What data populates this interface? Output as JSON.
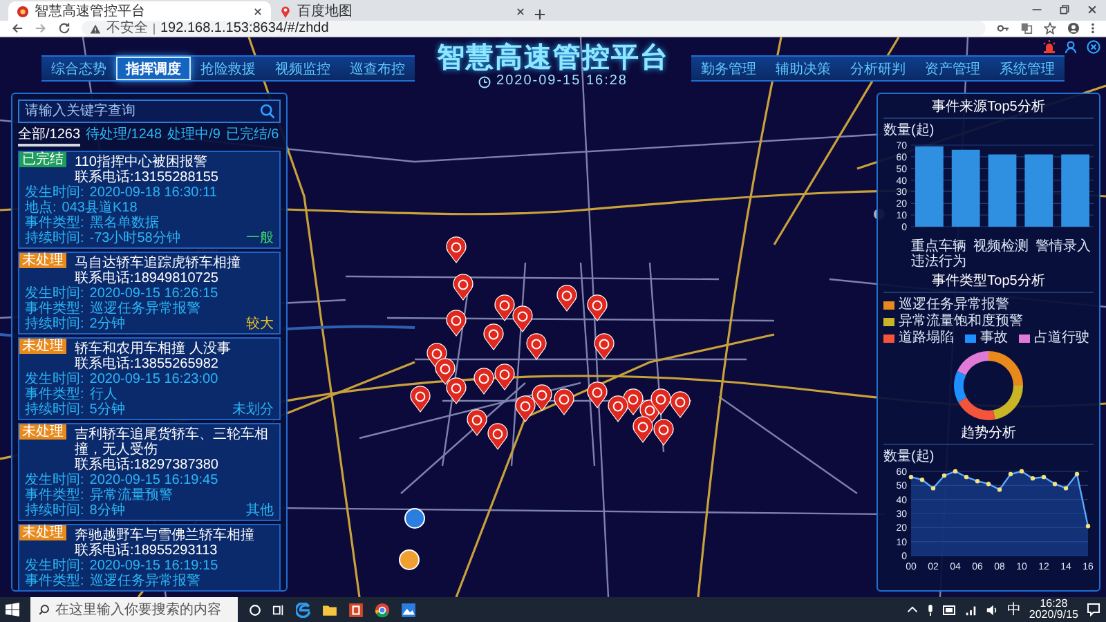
{
  "browser": {
    "tabs": [
      {
        "title": "智慧高速管控平台",
        "selected": true
      },
      {
        "title": "百度地图",
        "selected": false
      }
    ],
    "security": "不安全",
    "url": "192.168.1.153:8634/#/zhdd"
  },
  "header": {
    "title": "智慧高速管控平台",
    "datetime": "2020-09-15 16:28",
    "left_nav": [
      {
        "label": "综合态势",
        "selected": false
      },
      {
        "label": "指挥调度",
        "selected": true
      },
      {
        "label": "抢险救援",
        "selected": false
      },
      {
        "label": "视频监控",
        "selected": false
      },
      {
        "label": "巡查布控",
        "selected": false
      }
    ],
    "right_nav": [
      {
        "label": "勤务管理",
        "selected": false
      },
      {
        "label": "辅助决策",
        "selected": false
      },
      {
        "label": "分析研判",
        "selected": false
      },
      {
        "label": "资产管理",
        "selected": false
      },
      {
        "label": "系统管理",
        "selected": false
      }
    ]
  },
  "event_panel": {
    "search": {
      "placeholder": "请输入关键字查询"
    },
    "filters": [
      {
        "label": "全部/1263",
        "selected": true
      },
      {
        "label": "待处理/1248",
        "selected": false
      },
      {
        "label": "处理中/9",
        "selected": false
      },
      {
        "label": "已完结/6",
        "selected": false
      }
    ],
    "events": [
      {
        "badge": {
          "text": "已完结",
          "color": "#1f9d5c"
        },
        "title": "110指挥中心被困报警",
        "contact": "联系电话:13155288155",
        "fields": [
          {
            "label": "发生时间:",
            "value": "2020-09-18 16:30:11"
          },
          {
            "label": "地点:",
            "value": "043县道K18"
          },
          {
            "label": "事件类型:",
            "value": "黑名单数据"
          },
          {
            "label": "持续时间:",
            "value": "-73小时58分钟"
          }
        ],
        "severity": {
          "text": "一般",
          "color": "#3ccf6e"
        }
      },
      {
        "badge": {
          "text": "未处理",
          "color": "#e8891c"
        },
        "title": "马自达轿车追踪虎轿车相撞",
        "contact": "联系电话:18949810725",
        "fields": [
          {
            "label": "发生时间:",
            "value": "2020-09-15 16:26:15"
          },
          {
            "label": "事件类型:",
            "value": "巡逻任务异常报警"
          },
          {
            "label": "持续时间:",
            "value": "2分钟"
          }
        ],
        "severity": {
          "text": "较大",
          "color": "#e6c229"
        }
      },
      {
        "badge": {
          "text": "未处理",
          "color": "#e8891c"
        },
        "title": "轿车和农用车相撞 人没事",
        "contact": "联系电话:13855265982",
        "fields": [
          {
            "label": "发生时间:",
            "value": "2020-09-15 16:23:00"
          },
          {
            "label": "事件类型:",
            "value": "行人"
          },
          {
            "label": "持续时间:",
            "value": "5分钟"
          }
        ],
        "severity": {
          "text": "未划分",
          "color": "#29b6f6"
        }
      },
      {
        "badge": {
          "text": "未处理",
          "color": "#e8891c"
        },
        "title": "吉利轿车追尾货轿车、三轮车相撞，无人受伤",
        "contact": "联系电话:18297387380",
        "fields": [
          {
            "label": "发生时间:",
            "value": "2020-09-15 16:19:45"
          },
          {
            "label": "事件类型:",
            "value": "异常流量预警"
          },
          {
            "label": "持续时间:",
            "value": "8分钟"
          }
        ],
        "severity": {
          "text": "其他",
          "color": "#29b6f6"
        }
      },
      {
        "badge": {
          "text": "未处理",
          "color": "#e8891c"
        },
        "title": "奔驰越野车与雪佛兰轿车相撞",
        "contact": "联系电话:18955293113",
        "fields": [
          {
            "label": "发生时间:",
            "value": "2020-09-15 16:19:15"
          },
          {
            "label": "事件类型:",
            "value": "巡逻任务异常报警"
          }
        ]
      }
    ]
  },
  "analysis_panel": {
    "sections": [
      {
        "title": "事件来源Top5分析",
        "chart_data": {
          "type": "bar",
          "ylabel": "数量(起)",
          "categories": [
            "重点车辆违法行为",
            null,
            "视频检测",
            null,
            "警情录入"
          ],
          "values": [
            69,
            66,
            62,
            62,
            62
          ],
          "ylim": [
            0,
            70
          ],
          "grid": true,
          "yticks": [
            0,
            10,
            20,
            30,
            40,
            50,
            60,
            70
          ]
        }
      },
      {
        "title": "事件类型Top5分析",
        "chart_data": {
          "type": "donut",
          "legend": "top",
          "categories": [
            "巡逻任务异常报警",
            "异常流量饱和度预警",
            "道路塌陷",
            "事故",
            "占道行驶"
          ],
          "colors": [
            "#e8891c",
            "#c9b526",
            "#f4533c",
            "#1e90ff",
            "#e07ad6"
          ],
          "values": [
            25,
            22,
            20,
            15,
            18
          ]
        }
      },
      {
        "title": "趋势分析",
        "chart_data": {
          "type": "area",
          "ylabel": "数量(起)",
          "x": [
            0,
            1,
            2,
            3,
            4,
            5,
            6,
            7,
            8,
            9,
            10,
            11,
            12,
            13,
            14,
            15,
            16
          ],
          "values": [
            56,
            54,
            48,
            57,
            60,
            56,
            53,
            51,
            47,
            58,
            60,
            55,
            56,
            51,
            48,
            58,
            21
          ],
          "xlim": [
            0,
            16
          ],
          "ylim": [
            0,
            60
          ],
          "grid": true,
          "yticks": [
            0,
            10,
            20,
            30,
            40,
            50,
            60
          ],
          "xticks": [
            {
              "value": 0,
              "label": "00"
            },
            {
              "value": 2,
              "label": "02"
            },
            {
              "value": 4,
              "label": "04"
            },
            {
              "value": 6,
              "label": "06"
            },
            {
              "value": 8,
              "label": "08"
            },
            {
              "value": 10,
              "label": "10"
            },
            {
              "value": 12,
              "label": "12"
            },
            {
              "value": 14,
              "label": "14"
            },
            {
              "value": 16,
              "label": "16"
            }
          ]
        }
      }
    ]
  },
  "taskbar": {
    "search": {
      "placeholder": "在这里输入你要搜索的内容"
    },
    "ime": "中",
    "time": "16:28",
    "date": "2020/9/15"
  }
}
